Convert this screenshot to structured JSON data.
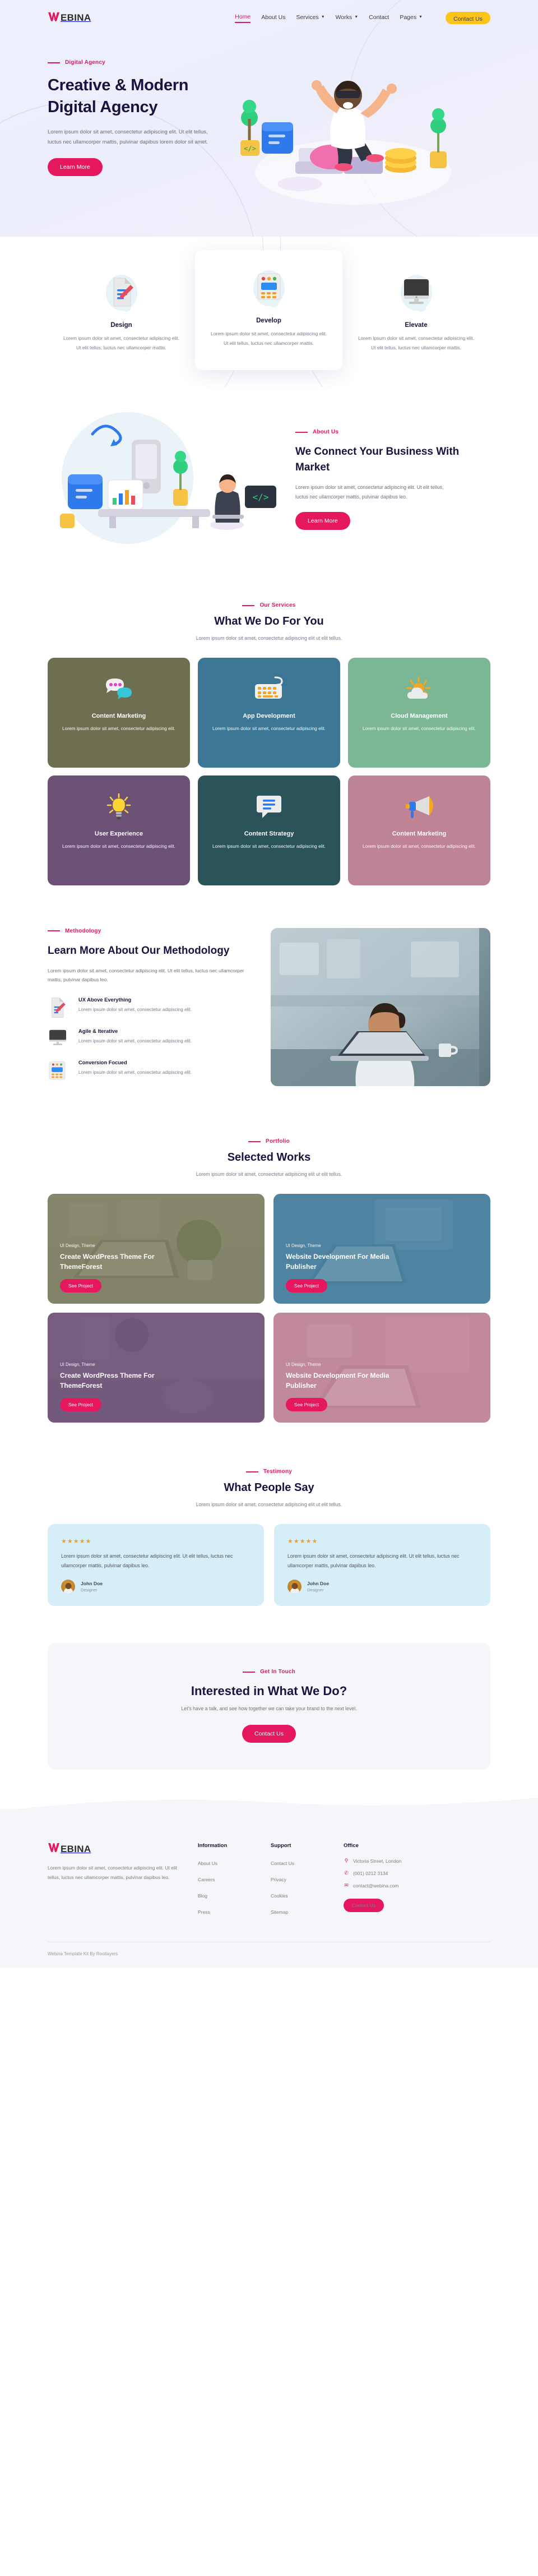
{
  "brand": {
    "w": "W",
    "rest": "EBINA",
    "accent": "#e5185f"
  },
  "header": {
    "nav": [
      {
        "label": "Home",
        "active": true,
        "caret": false
      },
      {
        "label": "About Us",
        "active": false,
        "caret": false
      },
      {
        "label": "Services",
        "active": false,
        "caret": true
      },
      {
        "label": "Works",
        "active": false,
        "caret": true
      },
      {
        "label": "Contact",
        "active": false,
        "caret": false
      },
      {
        "label": "Pages",
        "active": false,
        "caret": true
      }
    ],
    "cta_label": "Contact Us"
  },
  "hero": {
    "eyebrow": "Digital Agency",
    "title": "Creative & Modern Digital Agency",
    "desc": "Lorem ipsum dolor sit amet, consectetur adipiscing elit. Ut elit tellus, luctus nec ullamcorper mattis, pulvinar dapibus lorem dolor sit amet.",
    "button": "Learn More"
  },
  "features": [
    {
      "icon": "document-pencil-icon",
      "title": "Design",
      "desc": "Lorem ipsum dolor sit amet, consectetur adipiscing elit. Ut elit tellus, luctus nec ullamcorper mattis."
    },
    {
      "icon": "terminal-window-icon",
      "title": "Develop",
      "desc": "Lorem ipsum dolor sit amet, consectetur adipiscing elit. Ut elit tellus, luctus nec ullamcorper mattis."
    },
    {
      "icon": "imac-monitor-icon",
      "title": "Elevate",
      "desc": "Lorem ipsum dolor sit amet, consectetur adipiscing elit. Ut elit tellus, luctus nec ullamcorper mattis."
    }
  ],
  "about": {
    "eyebrow": "About Us",
    "title": "We Connect Your Business With Market",
    "desc": "Lorem ipsum dolor sit amet, consectetur adipiscing elit. Ut elit tellus, luctus nec ullamcorper mattis, pulvinar dapibus leo.",
    "button": "Learn More"
  },
  "services": {
    "eyebrow": "Our Services",
    "title": "What We Do For You",
    "subtitle": "Lorem ipsum dolor sit amet, consectetur adipiscing elit ut elit tellus.",
    "cards": [
      {
        "title": "Content Marketing",
        "desc": "Lorem ipsum dolor sit amet, consectetur adipiscing elit.",
        "bg": "#6e6f51",
        "icon": "chat-bubbles-icon"
      },
      {
        "title": "App Development",
        "desc": "Lorem ipsum dolor sit amet, consectetur adipiscing elit.",
        "bg": "#3b7795",
        "icon": "keyboard-icon"
      },
      {
        "title": "Cloud Management",
        "desc": "Lorem ipsum dolor sit amet, consectetur adipiscing elit.",
        "bg": "#7cb795",
        "icon": "sun-cloud-icon"
      },
      {
        "title": "User Experience",
        "desc": "Lorem ipsum dolor sit amet, consectetur adipiscing elit.",
        "bg": "#6d5076",
        "icon": "lightbulb-icon"
      },
      {
        "title": "Content Strategy",
        "desc": "Lorem ipsum dolor sit amet, consectetur adipiscing elit.",
        "bg": "#2b535a",
        "icon": "speech-lines-icon"
      },
      {
        "title": "Content Marketing",
        "desc": "Lorem ipsum dolor sit amet, consectetur adipiscing elit.",
        "bg": "#bf8396",
        "icon": "megaphone-icon"
      }
    ]
  },
  "methodology": {
    "eyebrow": "Methodology",
    "title": "Learn More About Our Methodology",
    "lead": "Lorem ipsum dolor sit amet, consectetur adipiscing elit. Ut elit tellus, luctus nec ullamcorper mattis, pulvinar dapibus leo.",
    "items": [
      {
        "icon": "document-pencil-icon",
        "title": "UX Above Everything",
        "desc": "Lorem ipsum dolor sit amet, consectetur adipiscing elit."
      },
      {
        "icon": "imac-monitor-icon",
        "title": "Agile & Iterative",
        "desc": "Lorem ipsum dolor sit amet, consectetur adipiscing elit."
      },
      {
        "icon": "terminal-window-icon",
        "title": "Conversion Focued",
        "desc": "Lorem ipsum dolor sit amet, consectetur adipiscing elit."
      }
    ]
  },
  "portfolio": {
    "eyebrow": "Portfolio",
    "title": "Selected Works",
    "subtitle": "Lorem ipsum dolor sit amet, consectetur adipiscing elit ut elit tellus.",
    "items": [
      {
        "cat": "UI Design, Theme",
        "title": "Create WordPress Theme For ThemeForest",
        "button": "See Project",
        "tint": "#6e6f51"
      },
      {
        "cat": "UI Design, Theme",
        "title": "Website Development For Media Publisher",
        "button": "See Project",
        "tint": "#3b7795"
      },
      {
        "cat": "UI Design, Theme",
        "title": "Create WordPress Theme For ThemeForest",
        "button": "See Project",
        "tint": "#6d5076"
      },
      {
        "cat": "UI Design, Theme",
        "title": "Website Development For Media Publisher",
        "button": "See Project",
        "tint": "#bf8396"
      }
    ]
  },
  "testimony": {
    "eyebrow": "Testimony",
    "title": "What People Say",
    "subtitle": "Lorem ipsum dolor sit amet, consectetur adipiscing elit ut elit tellus.",
    "items": [
      {
        "stars": "★★★★★",
        "quote": "Lorem ipsum dolor sit amet, consectetur adipiscing elit. Ut elit tellus, luctus nec ullamcorper mattis, pulvinar dapibus leo.",
        "name": "John Doe",
        "role": "Designer"
      },
      {
        "stars": "★★★★★",
        "quote": "Lorem ipsum dolor sit amet, consectetur adipiscing elit. Ut elit tellus, luctus nec ullamcorper mattis, pulvinar dapibus leo.",
        "name": "John Doe",
        "role": "Designer"
      }
    ]
  },
  "cta": {
    "eyebrow": "Get In Touch",
    "title": "Interested in What We Do?",
    "subtitle": "Let's have a talk, and see how together we can take your brand to the next level.",
    "button": "Contact Us"
  },
  "footer": {
    "desc": "Lorem ipsum dolor sit amet, consectetur adipiscing elit. Ut elit tellus, luctus nec ullamcorper mattis, pulvinar dapibus leo.",
    "columns": [
      {
        "heading": "Information",
        "links": [
          "About Us",
          "Careers",
          "Blog",
          "Press"
        ]
      },
      {
        "heading": "Support",
        "links": [
          "Contact Us",
          "Privacy",
          "Cookies",
          "Sitemap"
        ]
      }
    ],
    "office": {
      "heading": "Office",
      "address": "Victoria Street, London",
      "phone": "(001) 0212 3134",
      "email": "contact@webina.com",
      "button": "Contact Us"
    },
    "copyright": "Webina Template Kit By Rootlayers"
  }
}
